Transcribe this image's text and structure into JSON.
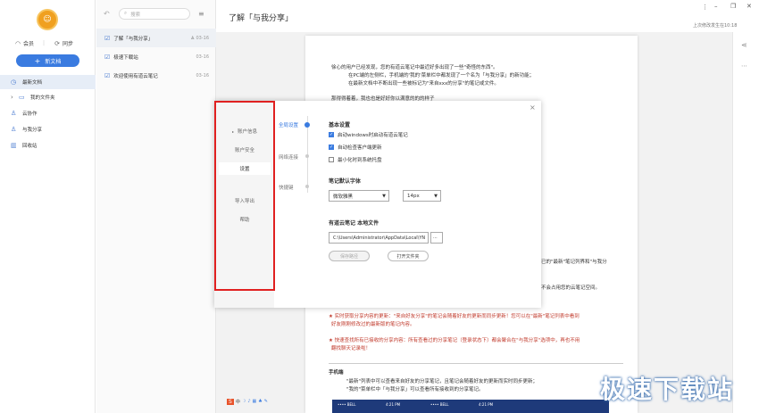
{
  "user": {
    "vip_label": "会员",
    "sync_label": "同步"
  },
  "new_doc_label": "新文档",
  "nav": [
    {
      "label": "最新文档",
      "icon": "clock-icon"
    },
    {
      "label": "我的文件夹",
      "icon": "folder-icon"
    },
    {
      "label": "云协作",
      "icon": "users-icon"
    },
    {
      "label": "与我分享",
      "icon": "share-icon"
    },
    {
      "label": "回收站",
      "icon": "trash-icon"
    }
  ],
  "search": {
    "placeholder": "搜索"
  },
  "notes": [
    {
      "title": "了解「与我分享」",
      "date": "03-16"
    },
    {
      "title": "极速下载站",
      "date": "03-16"
    },
    {
      "title": "欢迎使用有道云笔记",
      "date": "03-16"
    }
  ],
  "doc": {
    "title": "了解「与我分享」",
    "last_modified": "上次修改发生在10:18",
    "para1": "徐心的用户已经发现，您的有道云笔记中最近好多出现了一些\"奇怪的东西\"。",
    "bullet1": "在PC端的左侧栏，手机端的'我的'菜单栏中都发现了一个名为「与我分享」的新功能；",
    "bullet2": "在最新文档中不断出现一些被标记为\"来自xxx的分享\"的笔记或文件。",
    "para2": "那得得着着，我也也是好好你以满意的的的样子",
    "frag1": "已的\"最新\"笔记列界和\"与我分",
    "frag2": "不会占用您的云笔记空间。",
    "red1": "★ 实时获取分享内容的更新：\"来自好友分享\"的笔记会随着好友的更新而同步更新！您可以在\"最新\"笔记列表中看到",
    "red1b": "好友刚刚修改过的最新版的笔记内容。",
    "red2": "★ 快速查找所有已接收的分享内容：所有查看过的分享笔记（登录状态下）都会聚合在\"与我分享\"选项中，再也不用",
    "red2b": "翻找聊天记录啦！",
    "mobile_heading": "手机端",
    "mbullet1": "\"最新\"列表中可以查看来自好友的分享笔记，且笔记会随着好友的更新而实时同步更新；",
    "mbullet2": "\"我的\"菜单栏中「与我分享」可以查看所有接收到的分享笔记。"
  },
  "settings": {
    "left_menu": [
      "账户信息",
      "账户安全",
      "设置",
      "导入导出",
      "帮助"
    ],
    "tabs": [
      "全局设置",
      "网络连接",
      "快捷键"
    ],
    "basic_heading": "基本设置",
    "checkboxes": [
      {
        "label": "启动windows时启动有道云笔记",
        "checked": true
      },
      {
        "label": "自动检查客户端更新",
        "checked": true
      },
      {
        "label": "最小化时到系统托盘",
        "checked": false
      }
    ],
    "font_heading": "笔记默认字体",
    "font_family": "微软雅黑",
    "font_size": "14px",
    "local_heading": "有道云笔记 本地文件",
    "local_path": "C:\\Users\\Administrator\\AppData\\Local\\YN",
    "browse_label": "···",
    "save_path_label": "保存路径",
    "open_folder_label": "打开文件夹"
  },
  "watermark": "极速下载站",
  "phone_status": [
    "•••• BELL",
    "4:21 PM",
    "•••• BELL",
    "4:21 PM"
  ]
}
